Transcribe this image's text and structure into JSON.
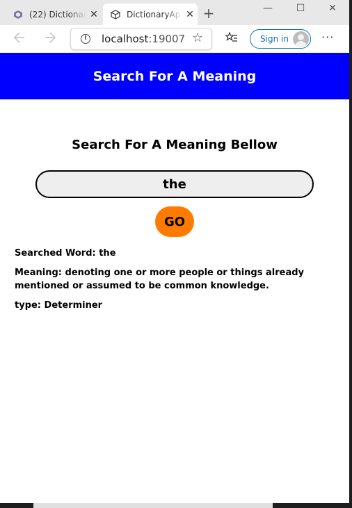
{
  "browser": {
    "tabs": [
      {
        "title": "(22) Dictionar",
        "close": "✕"
      },
      {
        "title": "DictionaryAp",
        "close": "✕"
      }
    ],
    "new_tab": "+",
    "window_controls": {
      "minimize": "—",
      "maximize": "☐",
      "close": "✕"
    },
    "url_host": "localhost",
    "url_port": ":19007",
    "sign_in": "Sign in"
  },
  "page": {
    "header": "Search For A Meaning",
    "subtitle": "Search For A Meaning Bellow",
    "search_value": "the",
    "go_label": "GO",
    "searched_word": "Searched Word: the",
    "meaning": "Meaning: denoting one or more people or things already mentioned or assumed to be common knowledge.",
    "type": "type: Determiner"
  },
  "colors": {
    "header_bg": "#0000ff",
    "go_button": "#ff7b00",
    "signin_accent": "#0f6cbd"
  },
  "icons": [
    "tab-favicon-icon",
    "cube-icon",
    "info-icon",
    "star-icon",
    "favorites-icon",
    "avatar-icon",
    "more-icon",
    "back-arrow-icon",
    "forward-arrow-icon"
  ]
}
